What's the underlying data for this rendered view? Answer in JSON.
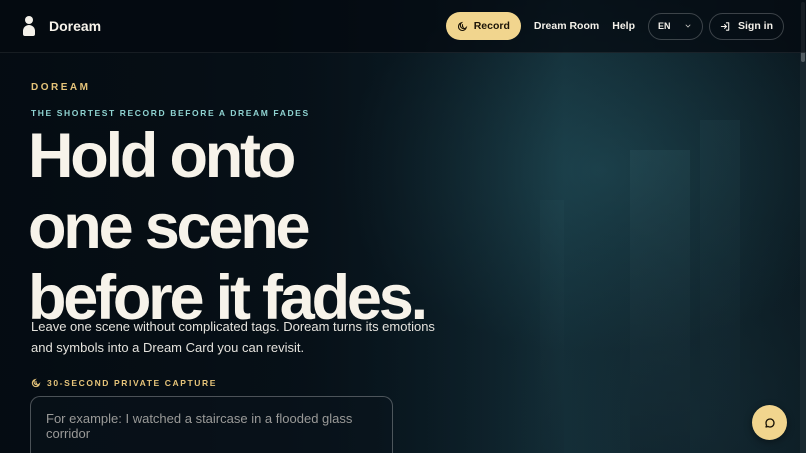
{
  "brand": {
    "name": "Doream",
    "logo_icon": "dreamer-logo-icon"
  },
  "nav": {
    "record_label": "Record",
    "record_icon": "moon-icon",
    "dream_room_label": "Dream Room",
    "help_label": "Help",
    "language_value": "EN",
    "language_icon": "chevron-down-icon",
    "sign_in_label": "Sign in",
    "sign_in_icon": "login-icon"
  },
  "hero": {
    "eyebrow": "DOREAM",
    "tagline": "THE SHORTEST RECORD BEFORE A DREAM FADES",
    "headline_line1": "Hold onto",
    "headline_line2": "one scene",
    "headline_line3": "before it fades.",
    "description": "Leave one scene without complicated tags. Doream turns its emotions and symbols into a Dream Card you can revisit.",
    "capture_label": "30-SECOND PRIVATE CAPTURE",
    "capture_icon": "moon-icon",
    "input_placeholder": "For example: I watched a staircase in a flooded glass corridor"
  },
  "chat_button": {
    "icon": "chat-bubble-icon"
  },
  "colors": {
    "accent": "#f1d58e",
    "eyebrow": "#e6c47a",
    "tagline": "#8fd3d1",
    "background": "#07121a"
  }
}
